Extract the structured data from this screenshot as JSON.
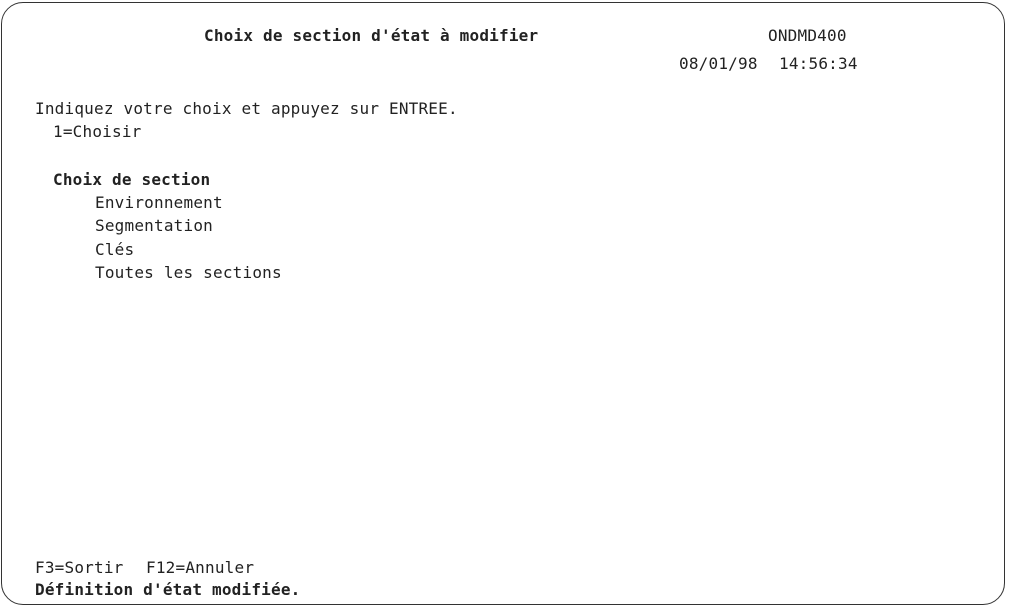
{
  "header": {
    "title": "Choix de section d'état à modifier",
    "screen_id": "ONDMD400",
    "date": "08/01/98",
    "time": "14:56:34"
  },
  "instructions": {
    "line1": "Indiquez votre choix et appuyez sur ENTREE.",
    "option": "1=Choisir"
  },
  "section_list": {
    "heading": "Choix de section",
    "items": [
      "Environnement",
      "Segmentation",
      "Clés",
      "Toutes les sections"
    ]
  },
  "footer": {
    "f3": "F3=Sortir",
    "f12": "F12=Annuler",
    "message": "Définition d'état modifiée."
  }
}
